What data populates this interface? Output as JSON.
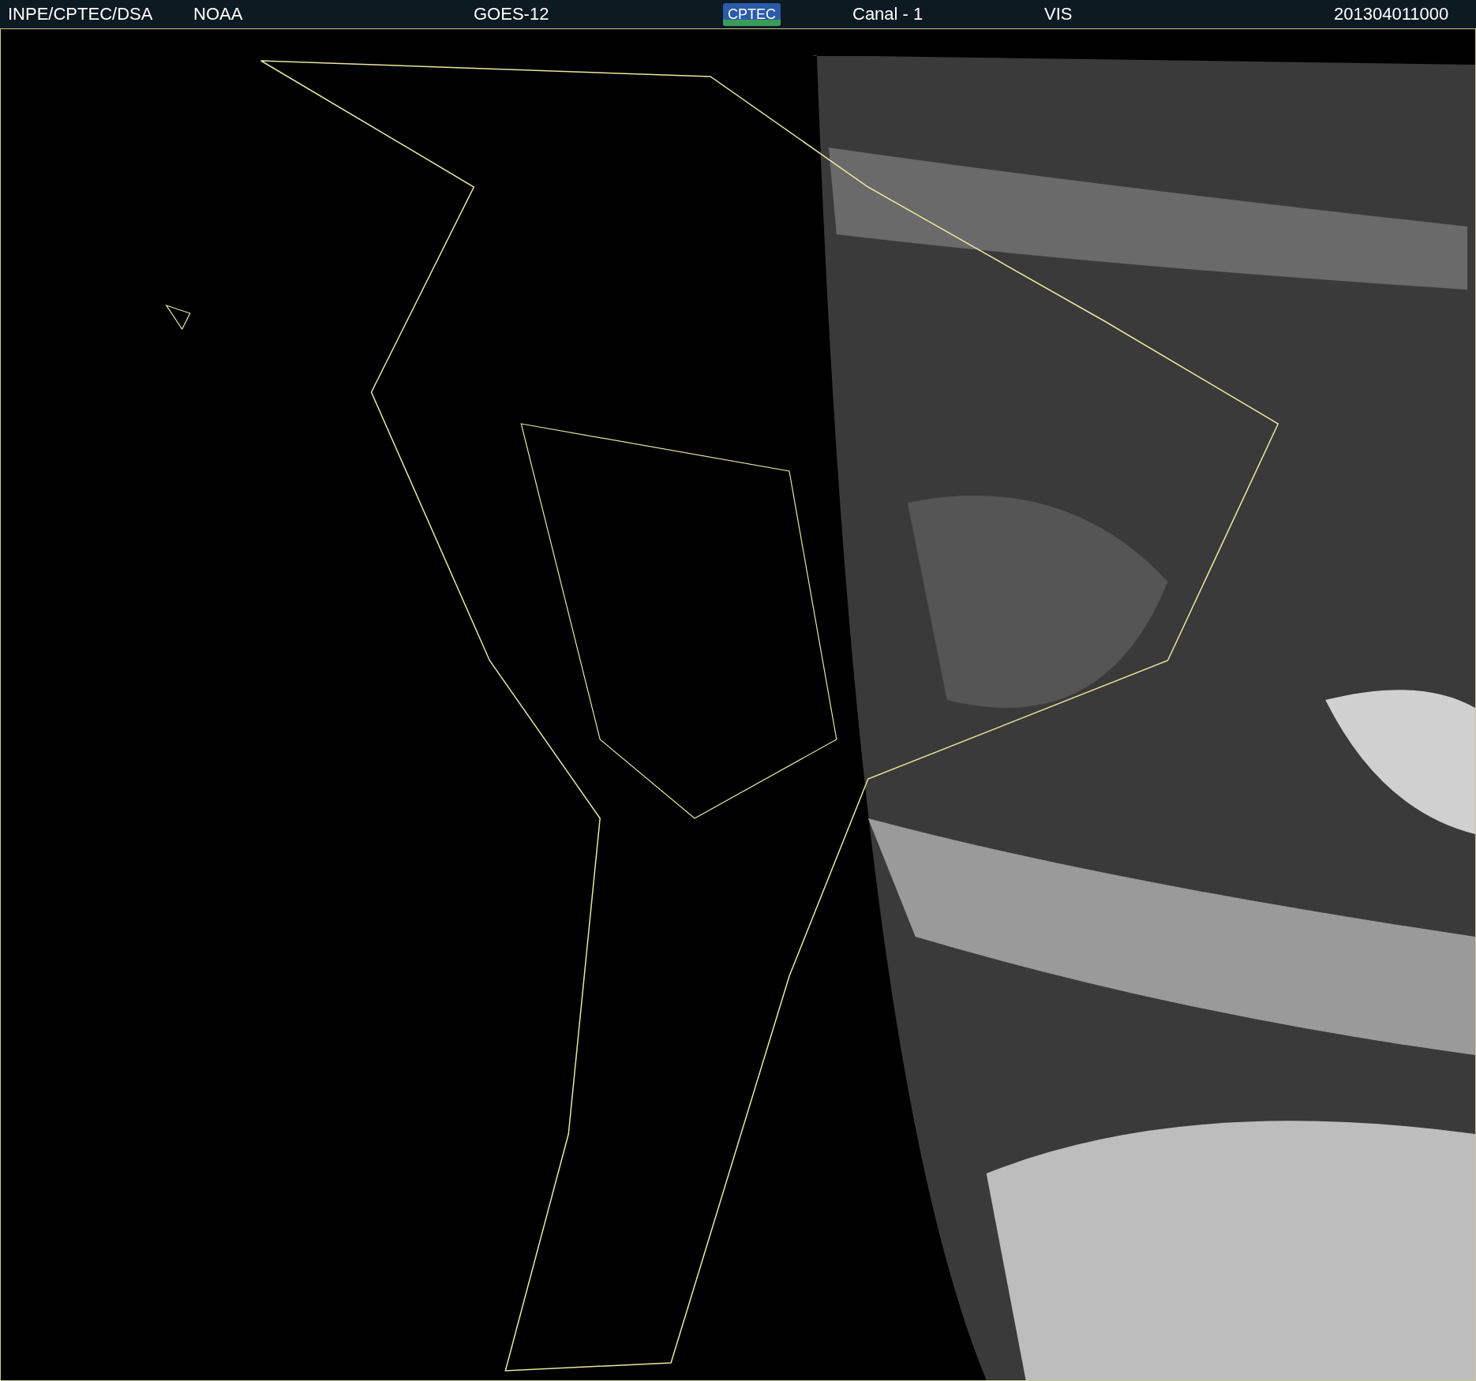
{
  "header": {
    "items": [
      {
        "kind": "text",
        "text": "INPE/CPTEC/DSA"
      },
      {
        "kind": "text",
        "text": "NOAA"
      },
      {
        "kind": "text",
        "text": "GOES-12"
      },
      {
        "kind": "logo",
        "text": "CPTEC"
      },
      {
        "kind": "text",
        "text": "Canal - 1"
      },
      {
        "kind": "text",
        "text": "VIS"
      },
      {
        "kind": "text",
        "text": "201304011000"
      }
    ]
  }
}
